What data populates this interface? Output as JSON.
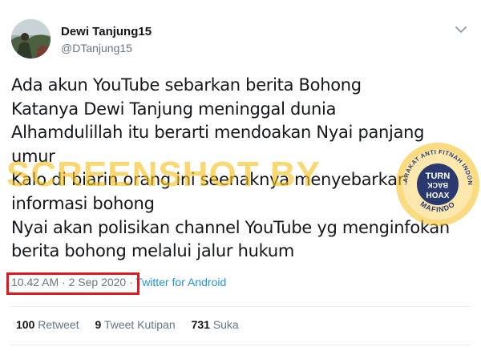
{
  "user": {
    "display_name": "Dewi Tanjung15",
    "handle": "@DTanjung15"
  },
  "tweet": {
    "lines": [
      "Ada akun YouTube sebarkan berita Bohong",
      "Katanya Dewi Tanjung meninggal dunia",
      "Alhamdulillah itu berarti mendoakan Nyai panjang",
      "umur",
      "Kalo di biarin orang ini seenaknya menyebarkan",
      "informasi bohong",
      "Nyai akan polisikan channel YouTube yg menginfokan",
      "berita bohong melalui jalur hukum"
    ],
    "timestamp": "10.42 AM · 2 Sep 2020",
    "separator": "·",
    "source": "Twitter for Android"
  },
  "stats": {
    "retweets_count": "100",
    "retweets_label": "Retweet",
    "quotes_count": "9",
    "quotes_label": "Tweet Kutipan",
    "likes_count": "731",
    "likes_label": "Suka"
  },
  "overlay": {
    "watermark": "SCREENSHOT BY",
    "badge_top_text": "MASYARAKAT ANTI FITNAH INDONESIA",
    "badge_center": [
      "TURN",
      "BACK",
      "HOAX"
    ],
    "badge_bottom_text": "MAFINDO"
  },
  "colors": {
    "link": "#1b95e0",
    "highlight_box": "#e0191f",
    "watermark": "#f7be18",
    "badge_navy": "#2b3a6e"
  },
  "icons": {
    "chevron": "chevron-down-icon"
  }
}
